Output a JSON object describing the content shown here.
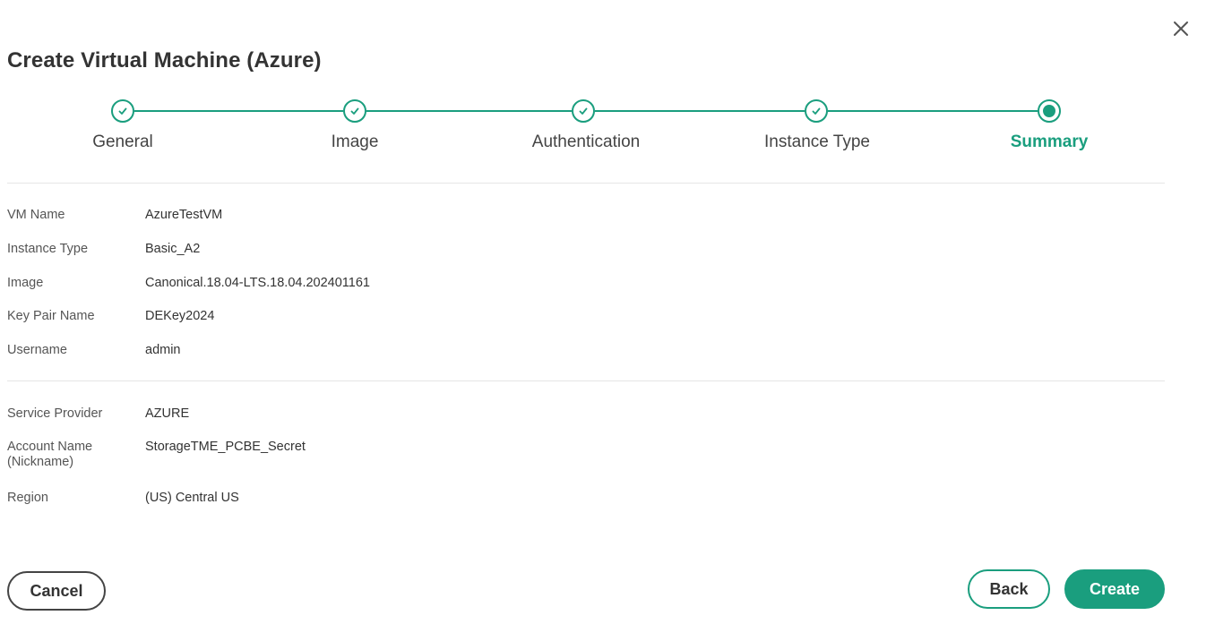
{
  "dialog": {
    "title": "Create Virtual Machine (Azure)"
  },
  "stepper": {
    "steps": [
      {
        "label": "General",
        "state": "completed"
      },
      {
        "label": "Image",
        "state": "completed"
      },
      {
        "label": "Authentication",
        "state": "completed"
      },
      {
        "label": "Instance Type",
        "state": "completed"
      },
      {
        "label": "Summary",
        "state": "active"
      }
    ]
  },
  "summary": {
    "vm_details": [
      {
        "label": "VM Name",
        "value": "AzureTestVM"
      },
      {
        "label": "Instance Type",
        "value": "Basic_A2"
      },
      {
        "label": "Image",
        "value": "Canonical.18.04-LTS.18.04.202401161"
      },
      {
        "label": "Key Pair Name",
        "value": "DEKey2024"
      },
      {
        "label": "Username",
        "value": "admin"
      }
    ],
    "account_details": [
      {
        "label": "Service Provider",
        "value": "AZURE"
      },
      {
        "label": "Account Name (Nickname)",
        "value": "StorageTME_PCBE_Secret"
      },
      {
        "label": "Region",
        "value": "(US) Central US"
      }
    ]
  },
  "footer": {
    "cancel_label": "Cancel",
    "back_label": "Back",
    "create_label": "Create"
  },
  "icons": {
    "close": "close-icon",
    "check": "check-icon"
  },
  "colors": {
    "accent": "#1a9e7e",
    "text": "#333333",
    "divider": "#e6e6e6"
  }
}
